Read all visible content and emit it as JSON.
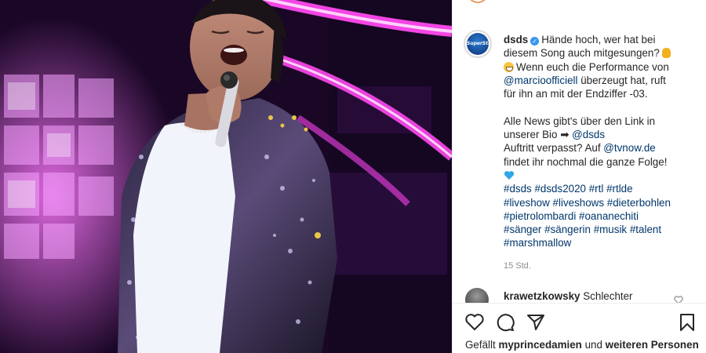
{
  "post": {
    "username": "dsds",
    "avatar_label": "SuperStar",
    "caption": {
      "line1": "Hände hoch, wer hat bei",
      "line2": "diesem Song auch mitgesungen?",
      "line3_rest": "Wenn euch die Performance von",
      "mention_marcio": "@marcioofficiell",
      "line4_rest": "überzeugt hat, ruft",
      "line5": "für ihn an mit der Endziffer -03.",
      "line6": "Alle News gibt's über den Link in",
      "line7_prefix": "unserer Bio ➡",
      "mention_dsds": "@dsds",
      "line8_prefix": "Auftritt verpasst? Auf",
      "mention_tvnow": "@tvnow.de",
      "line9": "findet ihr nochmal die ganze Folge!",
      "hashtags": [
        [
          "#dsds",
          "#dsds2020",
          "#rtl",
          "#rtlde"
        ],
        [
          "#liveshow",
          "#liveshows",
          "#dieterbohlen"
        ],
        [
          "#pietrolombardi",
          "#oananechiti"
        ],
        [
          "#sänger",
          "#sängerin",
          "#musik",
          "#talent"
        ],
        [
          "#marshmallow"
        ]
      ]
    },
    "time_ago": "15 Std."
  },
  "comment": {
    "username": "krawetzkowsky",
    "text": "Schlechter"
  },
  "likes": {
    "prefix": "Gefällt",
    "user": "myprincedamien",
    "connector": "und",
    "others": "weiteren Personen"
  },
  "icons": {
    "like": "heart-icon",
    "comment": "comment-icon",
    "share": "share-icon",
    "save": "bookmark-icon",
    "verified": "verified-icon"
  },
  "colors": {
    "link": "#00376b",
    "verified": "#3897f0",
    "muted": "#8e8e8e",
    "stage_pink": "#e83ee0"
  }
}
